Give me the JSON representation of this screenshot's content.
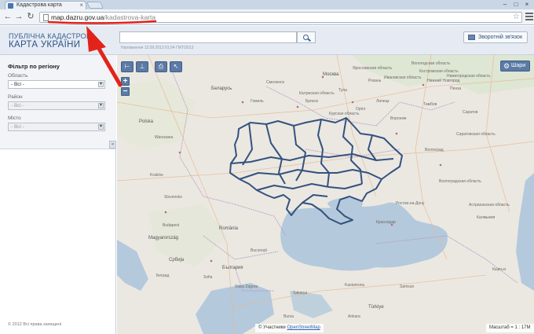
{
  "browser": {
    "tab_title": "Кадастрова карта",
    "url_domain": "map.dazru.gov.ua",
    "url_path": "/kadastrova-karta"
  },
  "header": {
    "logo_line1": "ПУБЛІЧНА КАДАСТРОВА",
    "logo_line2": "КАРТА УКРАЇНИ",
    "search_placeholder": "",
    "data_note": "Наповнення 12.09.2013 01:04 ГМТ/2013",
    "feedback_label": "Зворотній зв'язок"
  },
  "sidebar": {
    "filter_title": "Фільтр по регіону",
    "region_label": "Область",
    "region_value": "- Всі -",
    "district_label": "Район",
    "district_value": "- Всі -",
    "city_label": "Місто",
    "city_value": "- Всі -",
    "copyright": "© 2012 Всі права захищені"
  },
  "map": {
    "layers_label": "Шари",
    "attribution_prefix": "© Участники",
    "attribution_link": "OpenStreetMap",
    "scale_text": "Масштаб = 1 : 17M",
    "labels": [
      "Вологодская область",
      "Ярославская область",
      "Костромская область",
      "Ивановская область",
      "Москва",
      "Нижний Новгород",
      "Смоленск",
      "Калужская область",
      "Рязань",
      "Тула",
      "Пенза",
      "Брянск",
      "Орёл",
      "Курская область",
      "Воронеж",
      "Саратов",
      "Гомель",
      "Беларусь",
      "Волгоградская область",
      "Ростов-на-Дону",
      "Астраханская область",
      "Краснодар",
      "Калмыкия",
      "Warszawa",
      "Polska",
      "Kraków",
      "Slovensko",
      "Budapest",
      "Magyarország",
      "România",
      "Bucureşti",
      "Србија",
      "Беград",
      "България",
      "Sofia",
      "Stara Zagora",
      "Türkiye",
      "Kastamonu",
      "Samsun",
      "Sakarya",
      "Bursa",
      "Ankara",
      "Кыргыз",
      "Нижегородская область",
      "Липецк",
      "Тамбов",
      "Саратовская область",
      "Волгоград"
    ]
  }
}
